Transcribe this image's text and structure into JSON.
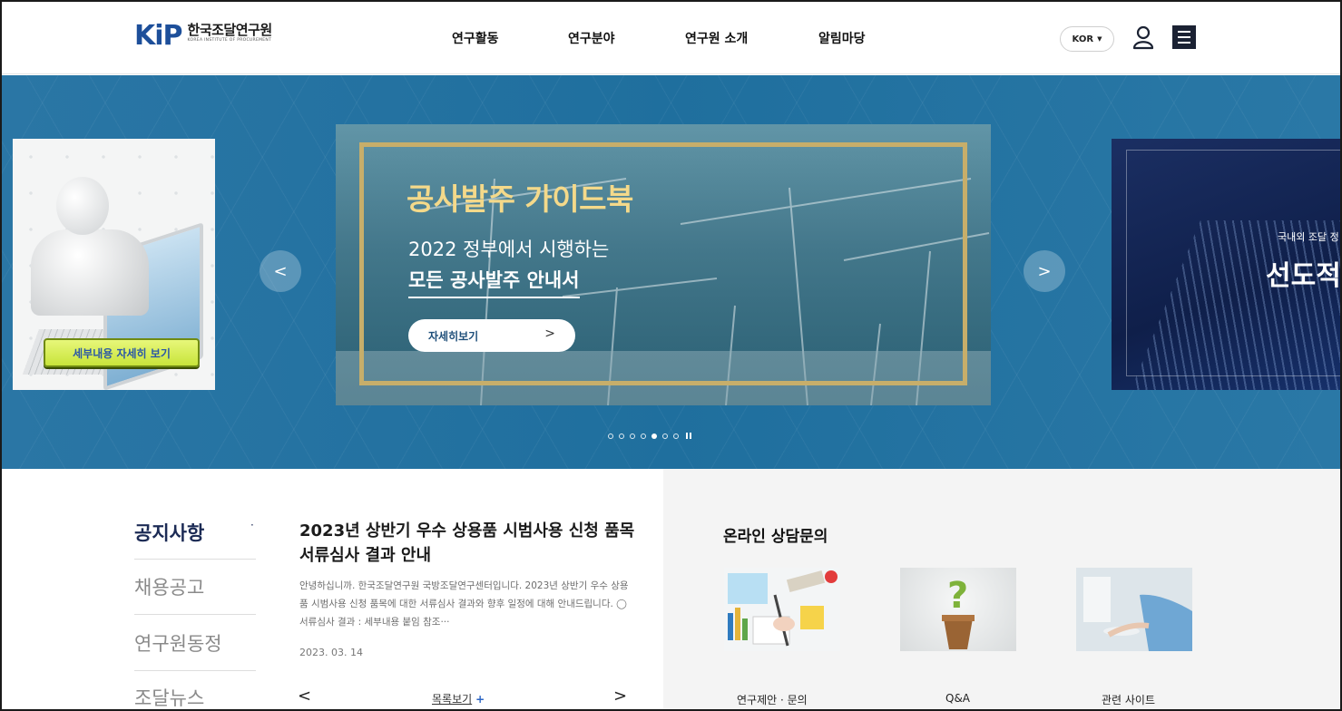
{
  "header": {
    "logo_mark": "KiP",
    "logo_kr": "한국조달연구원",
    "logo_en": "KOREA INSTITUTE OF PROCUREMENT",
    "nav": [
      "연구활동",
      "연구분야",
      "연구원 소개",
      "알림마당"
    ],
    "lang": "KOR"
  },
  "hero": {
    "left_slide_button": "세부내용 자세히 보기",
    "main_slide": {
      "title": "공사발주 가이드북",
      "subtitle1": "2022 정부에서 시행하는",
      "subtitle2": "모든 공사발주 안내서",
      "button": "자세히보기"
    },
    "right_slide": {
      "small": "국내외 조달 정",
      "big": "선도적"
    },
    "dots_total": 7,
    "dots_active_index": 4
  },
  "notice": {
    "tabs": [
      "공지사항",
      "채용공고",
      "연구원동정",
      "조달뉴스"
    ],
    "active_tab": 0,
    "title": "2023년 상반기 우수 상용품 시범사용 신청 품목 서류심사 결과 안내",
    "body": "안녕하십니까. 한국조달연구원 국방조달연구센터입니다. 2023년 상반기 우수 상용품 시범사용 신청 품목에 대한 서류심사 결과와 향후 일정에 대해 안내드립니다. ◯ 서류심사 결과 : 세부내용 붙임 참조···",
    "date": "2023. 03. 14",
    "list_link": "목록보기",
    "list_plus": "+"
  },
  "consult": {
    "title": "온라인 상담문의",
    "cards": [
      "연구제안 · 문의",
      "Q&A",
      "관련 사이트"
    ]
  },
  "colors": {
    "brand_blue": "#1d4f9a",
    "brand_red": "#e94b3c",
    "hero_bg": "#2272a1",
    "gold": "#c7ae6a",
    "title_gold": "#f4d98a",
    "active_tab": "#1c2b55"
  }
}
